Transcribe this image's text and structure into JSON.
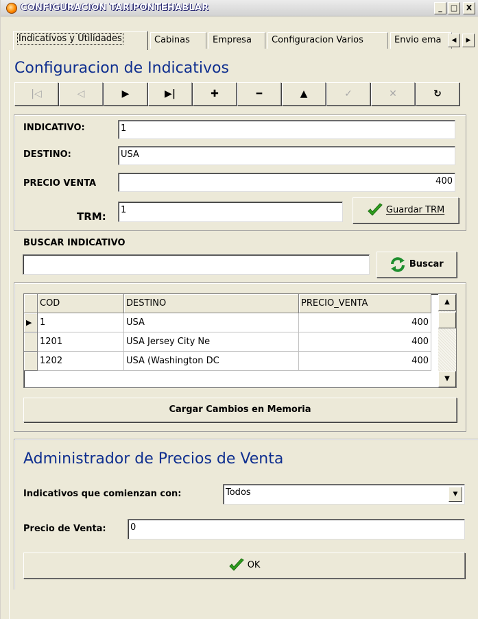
{
  "window": {
    "title": "CONFIGURACION TARIPONTEHABLAR",
    "min_label": "_",
    "max_label": "□",
    "close_label": "X"
  },
  "tabs": [
    {
      "label": "Indicativos y Utilidades"
    },
    {
      "label": "Cabinas"
    },
    {
      "label": "Empresa"
    },
    {
      "label": "Configuracion Varios"
    },
    {
      "label": "Envio ema"
    }
  ],
  "indicativos": {
    "title": "Configuracion de Indicativos",
    "nav": [
      {
        "glyph": "|◁",
        "name": "first",
        "enabled": false
      },
      {
        "glyph": "◁",
        "name": "prior",
        "enabled": false
      },
      {
        "glyph": "▶",
        "name": "next",
        "enabled": true
      },
      {
        "glyph": "▶|",
        "name": "last",
        "enabled": true
      },
      {
        "glyph": "✚",
        "name": "insert",
        "enabled": true
      },
      {
        "glyph": "━",
        "name": "delete",
        "enabled": true
      },
      {
        "glyph": "▲",
        "name": "edit",
        "enabled": true
      },
      {
        "glyph": "✓",
        "name": "post",
        "enabled": false
      },
      {
        "glyph": "✕",
        "name": "cancel",
        "enabled": false
      },
      {
        "glyph": "↻",
        "name": "refresh",
        "enabled": true
      }
    ],
    "fields": {
      "indicativo_label": "INDICATIVO:",
      "indicativo_value": "1",
      "destino_label": "DESTINO:",
      "destino_value": "USA",
      "precio_label": "PRECIO VENTA",
      "precio_value": "400",
      "trm_label": "TRM:",
      "trm_value": "1",
      "guardar_trm": "Guardar TRM"
    },
    "search": {
      "label": "BUSCAR INDICATIVO",
      "value": "",
      "button": "Buscar"
    },
    "grid": {
      "columns": [
        "COD",
        "DESTINO",
        "PRECIO_VENTA"
      ],
      "rows": [
        {
          "indicator": "▶",
          "cod": "1",
          "destino": "USA",
          "precio": "400"
        },
        {
          "indicator": "",
          "cod": "1201",
          "destino": "USA Jersey City Ne",
          "precio": "400"
        },
        {
          "indicator": "",
          "cod": "1202",
          "destino": "USA (Washington DC",
          "precio": "400"
        }
      ]
    },
    "load_button": "Cargar Cambios en Memoria"
  },
  "precios": {
    "title": "Administrador de Precios de Venta",
    "prefix_label": "Indicativos que comienzan con:",
    "prefix_value": "Todos",
    "precio_label": "Precio de Venta:",
    "precio_value": "0",
    "ok_button": "OK"
  },
  "colors": {
    "accent_title": "#0f2f8f",
    "check_green": "#2e9e1e",
    "refresh_green": "#1e8e2e"
  }
}
